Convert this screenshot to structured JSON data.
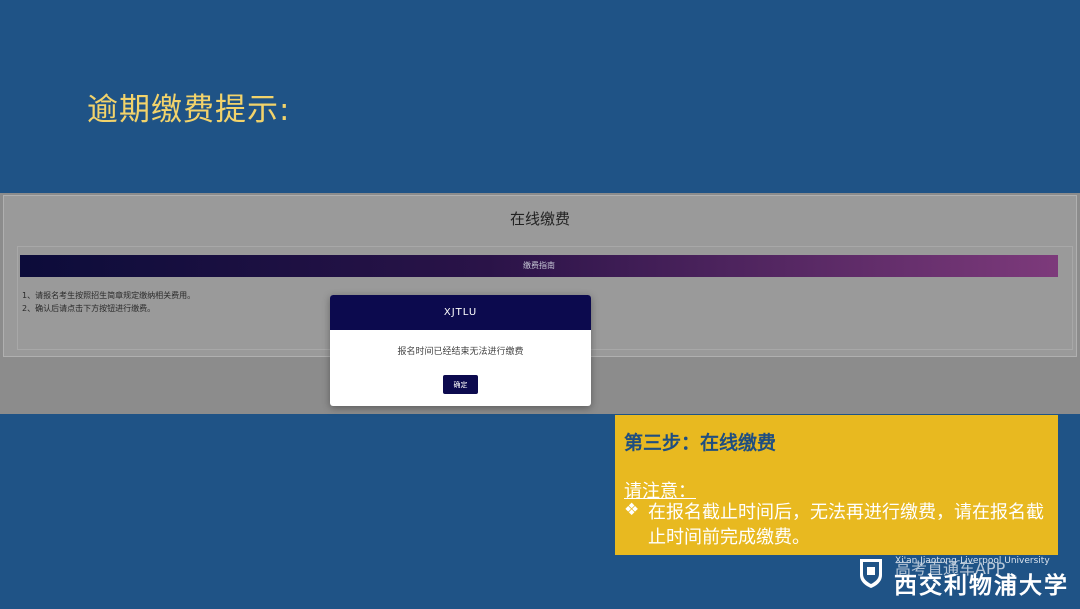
{
  "slide": {
    "title": "逾期缴费提示:"
  },
  "payment_page": {
    "title": "在线缴费",
    "guide_label": "缴费指南",
    "guide_lines": [
      "1、请报名考生按照招生简章规定缴纳相关费用。",
      "2、确认后请点击下方按钮进行缴费。"
    ]
  },
  "modal": {
    "header": "XJTLU",
    "message": "报名时间已经结束无法进行缴费",
    "confirm_label": "确定"
  },
  "note": {
    "heading": "第三步：在线缴费",
    "label": "请注意：",
    "bullet": "❖",
    "text": "在报名截止时间后，无法再进行缴费，请在报名截止时间前完成缴费。"
  },
  "footer": {
    "university_en": "Xi'an Jiaotong-Liverpool University",
    "university_zh": "西交利物浦大学",
    "watermark": "高考直通车APP"
  },
  "colors": {
    "background": "#1f5386",
    "title": "#f2d36b",
    "modal_header": "#0c0a4e",
    "note_box": "#e8b920"
  }
}
